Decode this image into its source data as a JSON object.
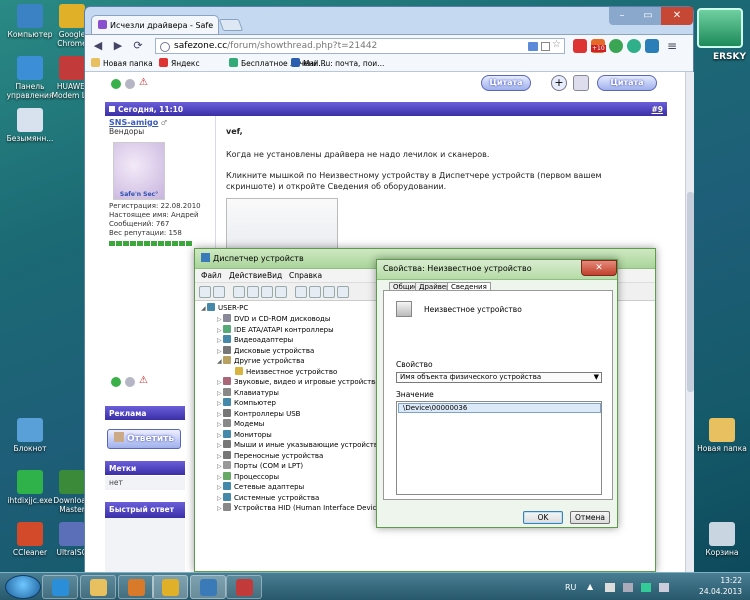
{
  "desktop": {
    "icons_left": [
      {
        "label": "Компьютер",
        "color": "#3b82c4"
      },
      {
        "label": "Google Chrome",
        "color": "#e0b028"
      },
      {
        "label": "Панель управления",
        "color": "#3c8ed6"
      },
      {
        "label": "HUAWEI Modem Liv",
        "color": "#c23a3a"
      },
      {
        "label": "Безымянн...",
        "color": "#d8e2ee"
      },
      {
        "label": "Блокнот",
        "color": "#5aa0d8"
      },
      {
        "label": "ihtdixjjc.exe",
        "color": "#2fb24a"
      },
      {
        "label": "Download Master",
        "color": "#3a8a3a"
      },
      {
        "label": "CCleaner",
        "color": "#d24a2a"
      },
      {
        "label": "UltraISO",
        "color": "#5a6fb8"
      }
    ],
    "icons_right": [
      {
        "label": "Новая папка",
        "color": "#e8c060"
      },
      {
        "label": "Корзина",
        "color": "#c9d6e2"
      }
    ],
    "kaspersky_text": "ERSKY"
  },
  "browser": {
    "tab_title": "Исчезли драйвера - Safe",
    "url_domain": "safezone.cc",
    "url_path": "/forum/showthread.php?t=21442",
    "bookmarks": [
      {
        "label": "Новая папка",
        "color": "#e8c060"
      },
      {
        "label": "Яндекс",
        "color": "#d33"
      },
      {
        "label": "Бесплатное лечени...",
        "color": "#3a7"
      },
      {
        "label": "Mail.Ru: почта, пои...",
        "color": "#2a5fb0"
      }
    ],
    "ext_badge": "+10"
  },
  "forum": {
    "quote_label": "Цитата",
    "post": {
      "date": "Сегодня, 11:10",
      "number": "#9",
      "username": "SNS-amigo",
      "role": "Вендоры",
      "avatar_caption": "Safe'n Sec°",
      "info": [
        "Регистрация: 22.08.2010",
        "Настоящее имя: Андрей",
        "Сообщений: 767",
        "Вес репутации: 158"
      ],
      "greeting": "vef,",
      "paragraph1": "Когда не установлены драйвера не надо лечилок и сканеров.",
      "paragraph2": "Кликните мышкой по Неизвестному устройству в Диспетчере устройств (первом вашем скриншоте) и откройте Сведения об оборудовании."
    },
    "sections": {
      "ads": "Реклама",
      "reply": "Ответить",
      "tags": "Метки",
      "tags_value": "нет",
      "quick_reply": "Быстрый ответ"
    }
  },
  "device_manager": {
    "title": "Диспетчер устройств",
    "menu": [
      "Файл",
      "Действие",
      "Вид",
      "Справка"
    ],
    "root": "USER-PC",
    "items": [
      {
        "label": "DVD и CD-ROM дисководы",
        "expanded": false,
        "level": 1,
        "color": "#889"
      },
      {
        "label": "IDE ATA/ATAPI контроллеры",
        "expanded": false,
        "level": 1,
        "color": "#5a7"
      },
      {
        "label": "Видеоадаптеры",
        "expanded": false,
        "level": 1,
        "color": "#48a"
      },
      {
        "label": "Дисковые устройства",
        "expanded": false,
        "level": 1,
        "color": "#777"
      },
      {
        "label": "Другие устройства",
        "expanded": true,
        "level": 1,
        "color": "#b8a060"
      },
      {
        "label": "Неизвестное устройство",
        "expanded": false,
        "level": 2,
        "color": "#d9b440"
      },
      {
        "label": "Звуковые, видео и игровые устройства",
        "expanded": false,
        "level": 1,
        "color": "#a67"
      },
      {
        "label": "Клавиатуры",
        "expanded": false,
        "level": 1,
        "color": "#888"
      },
      {
        "label": "Компьютер",
        "expanded": false,
        "level": 1,
        "color": "#48a"
      },
      {
        "label": "Контроллеры USB",
        "expanded": false,
        "level": 1,
        "color": "#777"
      },
      {
        "label": "Модемы",
        "expanded": false,
        "level": 1,
        "color": "#888"
      },
      {
        "label": "Мониторы",
        "expanded": false,
        "level": 1,
        "color": "#48a"
      },
      {
        "label": "Мыши и иные указывающие устройства",
        "expanded": false,
        "level": 1,
        "color": "#777"
      },
      {
        "label": "Переносные устройства",
        "expanded": false,
        "level": 1,
        "color": "#777"
      },
      {
        "label": "Порты (COM и LPT)",
        "expanded": false,
        "level": 1,
        "color": "#999"
      },
      {
        "label": "Процессоры",
        "expanded": false,
        "level": 1,
        "color": "#6a6"
      },
      {
        "label": "Сетевые адаптеры",
        "expanded": false,
        "level": 1,
        "color": "#48a"
      },
      {
        "label": "Системные устройства",
        "expanded": false,
        "level": 1,
        "color": "#48a"
      },
      {
        "label": "Устройства HID (Human Interface Devices)",
        "expanded": false,
        "level": 1,
        "color": "#888"
      }
    ]
  },
  "properties": {
    "title": "Свойства: Неизвестное устройство",
    "tabs": [
      "Общие",
      "Драйвер",
      "Сведения"
    ],
    "active_tab": "Сведения",
    "device_name": "Неизвестное устройство",
    "property_label": "Свойство",
    "property_value": "Имя объекта физического устройства",
    "value_label": "Значение",
    "value_item": "\\Device\\00000036",
    "ok": "OK",
    "cancel": "Отмена"
  },
  "taskbar": {
    "lang": "RU",
    "time": "13:22",
    "date": "24.04.2013",
    "buttons": [
      {
        "name": "ie",
        "color": "#2a8fd8"
      },
      {
        "name": "explorer",
        "color": "#e8c060"
      },
      {
        "name": "media",
        "color": "#d87a2a"
      },
      {
        "name": "chrome",
        "color": "#e0b028"
      },
      {
        "name": "devmgr",
        "color": "#3a7ab8"
      },
      {
        "name": "screenshot",
        "color": "#c23a3a"
      }
    ]
  }
}
